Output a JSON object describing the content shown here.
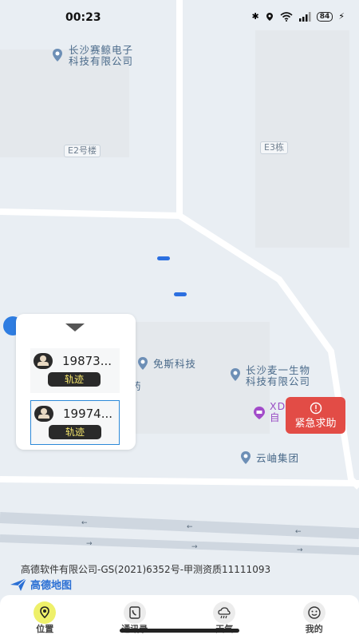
{
  "status_bar": {
    "time": "00:23",
    "battery": "84"
  },
  "map": {
    "pois": [
      {
        "line1": "长沙赛鲸电子",
        "line2": "科技有限公司"
      },
      {
        "line1": "免斯科技",
        "line2": ""
      },
      {
        "line1": "长沙麦一生物",
        "line2": "科技有限公司"
      },
      {
        "line1": "XD",
        "line2": "自"
      },
      {
        "line1": "云岫集团",
        "line2": ""
      }
    ],
    "road_labels": [
      "E2号楼",
      "E3栋"
    ],
    "fragment": "药"
  },
  "panel": {
    "devices": [
      {
        "phone": "19873...",
        "track_label": "轨迹"
      },
      {
        "phone": "19974...",
        "track_label": "轨迹"
      }
    ]
  },
  "sos": {
    "label": "紧急求助"
  },
  "footer": {
    "copyright": "高德软件有限公司-GS(2021)6352号-甲测资质11111093",
    "logo": "高德地图"
  },
  "tabs": [
    {
      "label": "位置",
      "icon": "location-icon",
      "active": true
    },
    {
      "label": "通讯录",
      "icon": "phone-book-icon",
      "active": false
    },
    {
      "label": "天气",
      "icon": "weather-icon",
      "active": false
    },
    {
      "label": "我的",
      "icon": "profile-icon",
      "active": false
    }
  ],
  "colors": {
    "sos": "#e24c46",
    "track_text": "#f3e46b",
    "location_dot": "#2b6fe0",
    "accent": "#2c89d8"
  }
}
